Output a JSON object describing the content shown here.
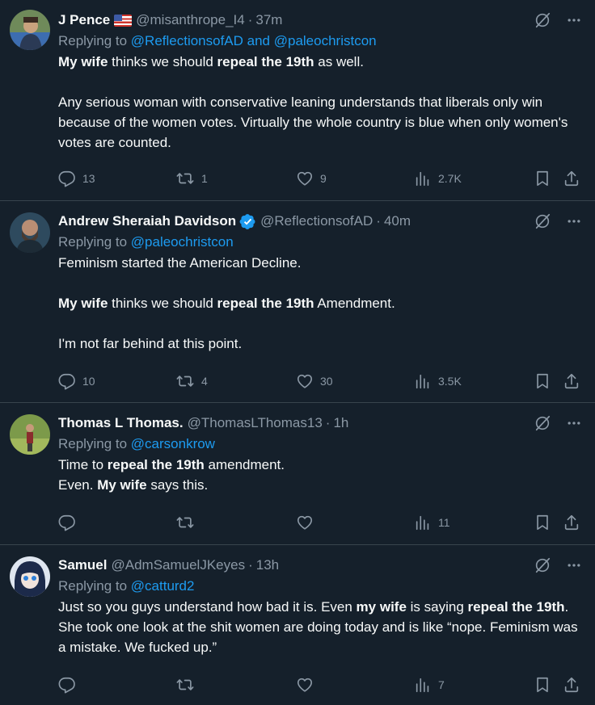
{
  "tweets": [
    {
      "name": "J Pence",
      "handle": "@misanthrope_I4",
      "time": "37m",
      "reply_prefix": "Replying to ",
      "reply_to": "@ReflectionsofAD and @paleochristcon",
      "body": [
        [
          {
            "b": true,
            "t": "My wife"
          },
          {
            "t": " thinks we should "
          },
          {
            "b": true,
            "t": "repeal the 19th"
          },
          {
            "t": " as well."
          }
        ],
        [
          {
            "t": "Any serious woman with conservative leaning understands that liberals only win because of the women votes. Virtually the whole country is blue when only women's votes are counted."
          }
        ]
      ],
      "replies": "13",
      "reposts": "1",
      "likes": "9",
      "views": "2.7K"
    },
    {
      "name": "Andrew Sheraiah Davidson",
      "handle": "@ReflectionsofAD",
      "time": "40m",
      "reply_prefix": "Replying to ",
      "reply_to": "@paleochristcon",
      "body": [
        [
          {
            "t": "Feminism started the American Decline."
          }
        ],
        [
          {
            "b": true,
            "t": "My wife"
          },
          {
            "t": " thinks we should "
          },
          {
            "b": true,
            "t": "repeal the 19th"
          },
          {
            "t": " Amendment."
          }
        ],
        [
          {
            "t": "I'm not far behind at this point."
          }
        ]
      ],
      "replies": "10",
      "reposts": "4",
      "likes": "30",
      "views": "3.5K"
    },
    {
      "name": "Thomas L Thomas.",
      "handle": "@ThomasLThomas13",
      "time": "1h",
      "reply_prefix": "Replying to ",
      "reply_to": "@carsonkrow",
      "body": [
        [
          {
            "t": "Time to "
          },
          {
            "b": true,
            "t": "repeal the 19th"
          },
          {
            "t": " amendment."
          },
          {
            "br": true
          },
          {
            "t": "Even. "
          },
          {
            "b": true,
            "t": "My wife"
          },
          {
            "t": " says this."
          }
        ]
      ],
      "replies": "",
      "reposts": "",
      "likes": "",
      "views": "11"
    },
    {
      "name": "Samuel",
      "handle": "@AdmSamuelJKeyes",
      "time": "13h",
      "reply_prefix": "Replying to ",
      "reply_to": "@catturd2",
      "body": [
        [
          {
            "t": "Just so you guys understand how bad it is. Even "
          },
          {
            "b": true,
            "t": "my wife"
          },
          {
            "t": " is saying "
          },
          {
            "b": true,
            "t": "repeal the 19th"
          },
          {
            "t": ". She took one look at the shit women are doing today and is like “nope. Feminism was a mistake. We fucked up.”"
          }
        ]
      ],
      "replies": "",
      "reposts": "",
      "likes": "",
      "views": "7"
    }
  ],
  "icons": {
    "reply": "reply-icon",
    "repost": "repost-icon",
    "like": "heart-icon",
    "views": "views-icon",
    "bookmark": "bookmark-icon",
    "share": "share-icon",
    "more": "more-icon",
    "grok": "grok-icon",
    "verified": "verified-badge-icon",
    "flag": "us-flag-icon"
  },
  "colors": {
    "background": "#15202b",
    "text": "#f7f9f9",
    "secondary": "#8b98a5",
    "link": "#1d9bf0",
    "divider": "#38444d"
  }
}
